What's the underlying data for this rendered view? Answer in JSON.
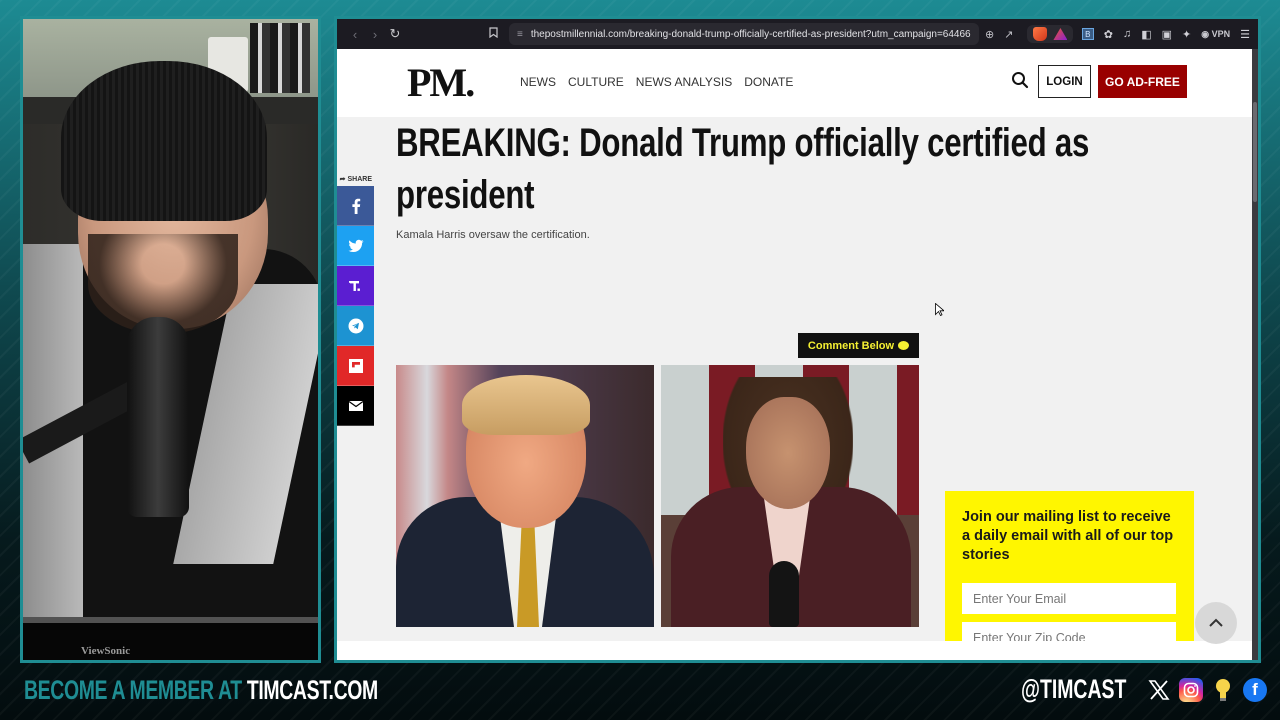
{
  "browser": {
    "url": "thepostmillennial.com/breaking-donald-trump-officially-certified-as-president?utm_campaign=64466",
    "vpn_label": "VPN",
    "icons": [
      "back-icon",
      "forward-icon",
      "reload-icon",
      "bookmark-icon",
      "site-settings-icon",
      "zoom-icon",
      "share-icon",
      "brave-shields-icon",
      "brave-rewards-icon",
      "sidebar-icon",
      "extensions-icon",
      "media-icon",
      "reader-icon",
      "wallet-icon",
      "leo-ai-icon",
      "vpn-icon",
      "menu-icon"
    ]
  },
  "site": {
    "logo": "PM.",
    "nav": [
      "NEWS",
      "CULTURE",
      "NEWS ANALYSIS",
      "DONATE"
    ],
    "login_label": "LOGIN",
    "adfree_label": "GO AD-FREE"
  },
  "article": {
    "headline": "BREAKING: Donald Trump officially certified as president",
    "subhead": "Kamala Harris oversaw the certification.",
    "share_label": "SHARE",
    "share_buttons": [
      {
        "name": "facebook",
        "color": "#3b5998"
      },
      {
        "name": "twitter",
        "color": "#1da1f2"
      },
      {
        "name": "truth-social",
        "color": "#5b1ed1"
      },
      {
        "name": "telegram",
        "color": "#1d93d2"
      },
      {
        "name": "flipboard",
        "color": "#e12828"
      },
      {
        "name": "email",
        "color": "#000000"
      }
    ],
    "comment_label": "Comment Below",
    "images": [
      {
        "alt": "Donald Trump"
      },
      {
        "alt": "Kamala Harris"
      }
    ]
  },
  "newsletter": {
    "heading": "Join our mailing list to receive a daily email with all of our top stories",
    "email_placeholder": "Enter Your Email",
    "zip_placeholder": "Enter Your Zip Code",
    "bg_color": "#fff600"
  },
  "stream": {
    "cta_prefix": "BECOME A MEMBER AT ",
    "cta_site": "TIMCAST.COM",
    "handle": "@TIMCAST",
    "monitor_brand": "ViewSonic",
    "accent_color": "#1f8d93"
  }
}
